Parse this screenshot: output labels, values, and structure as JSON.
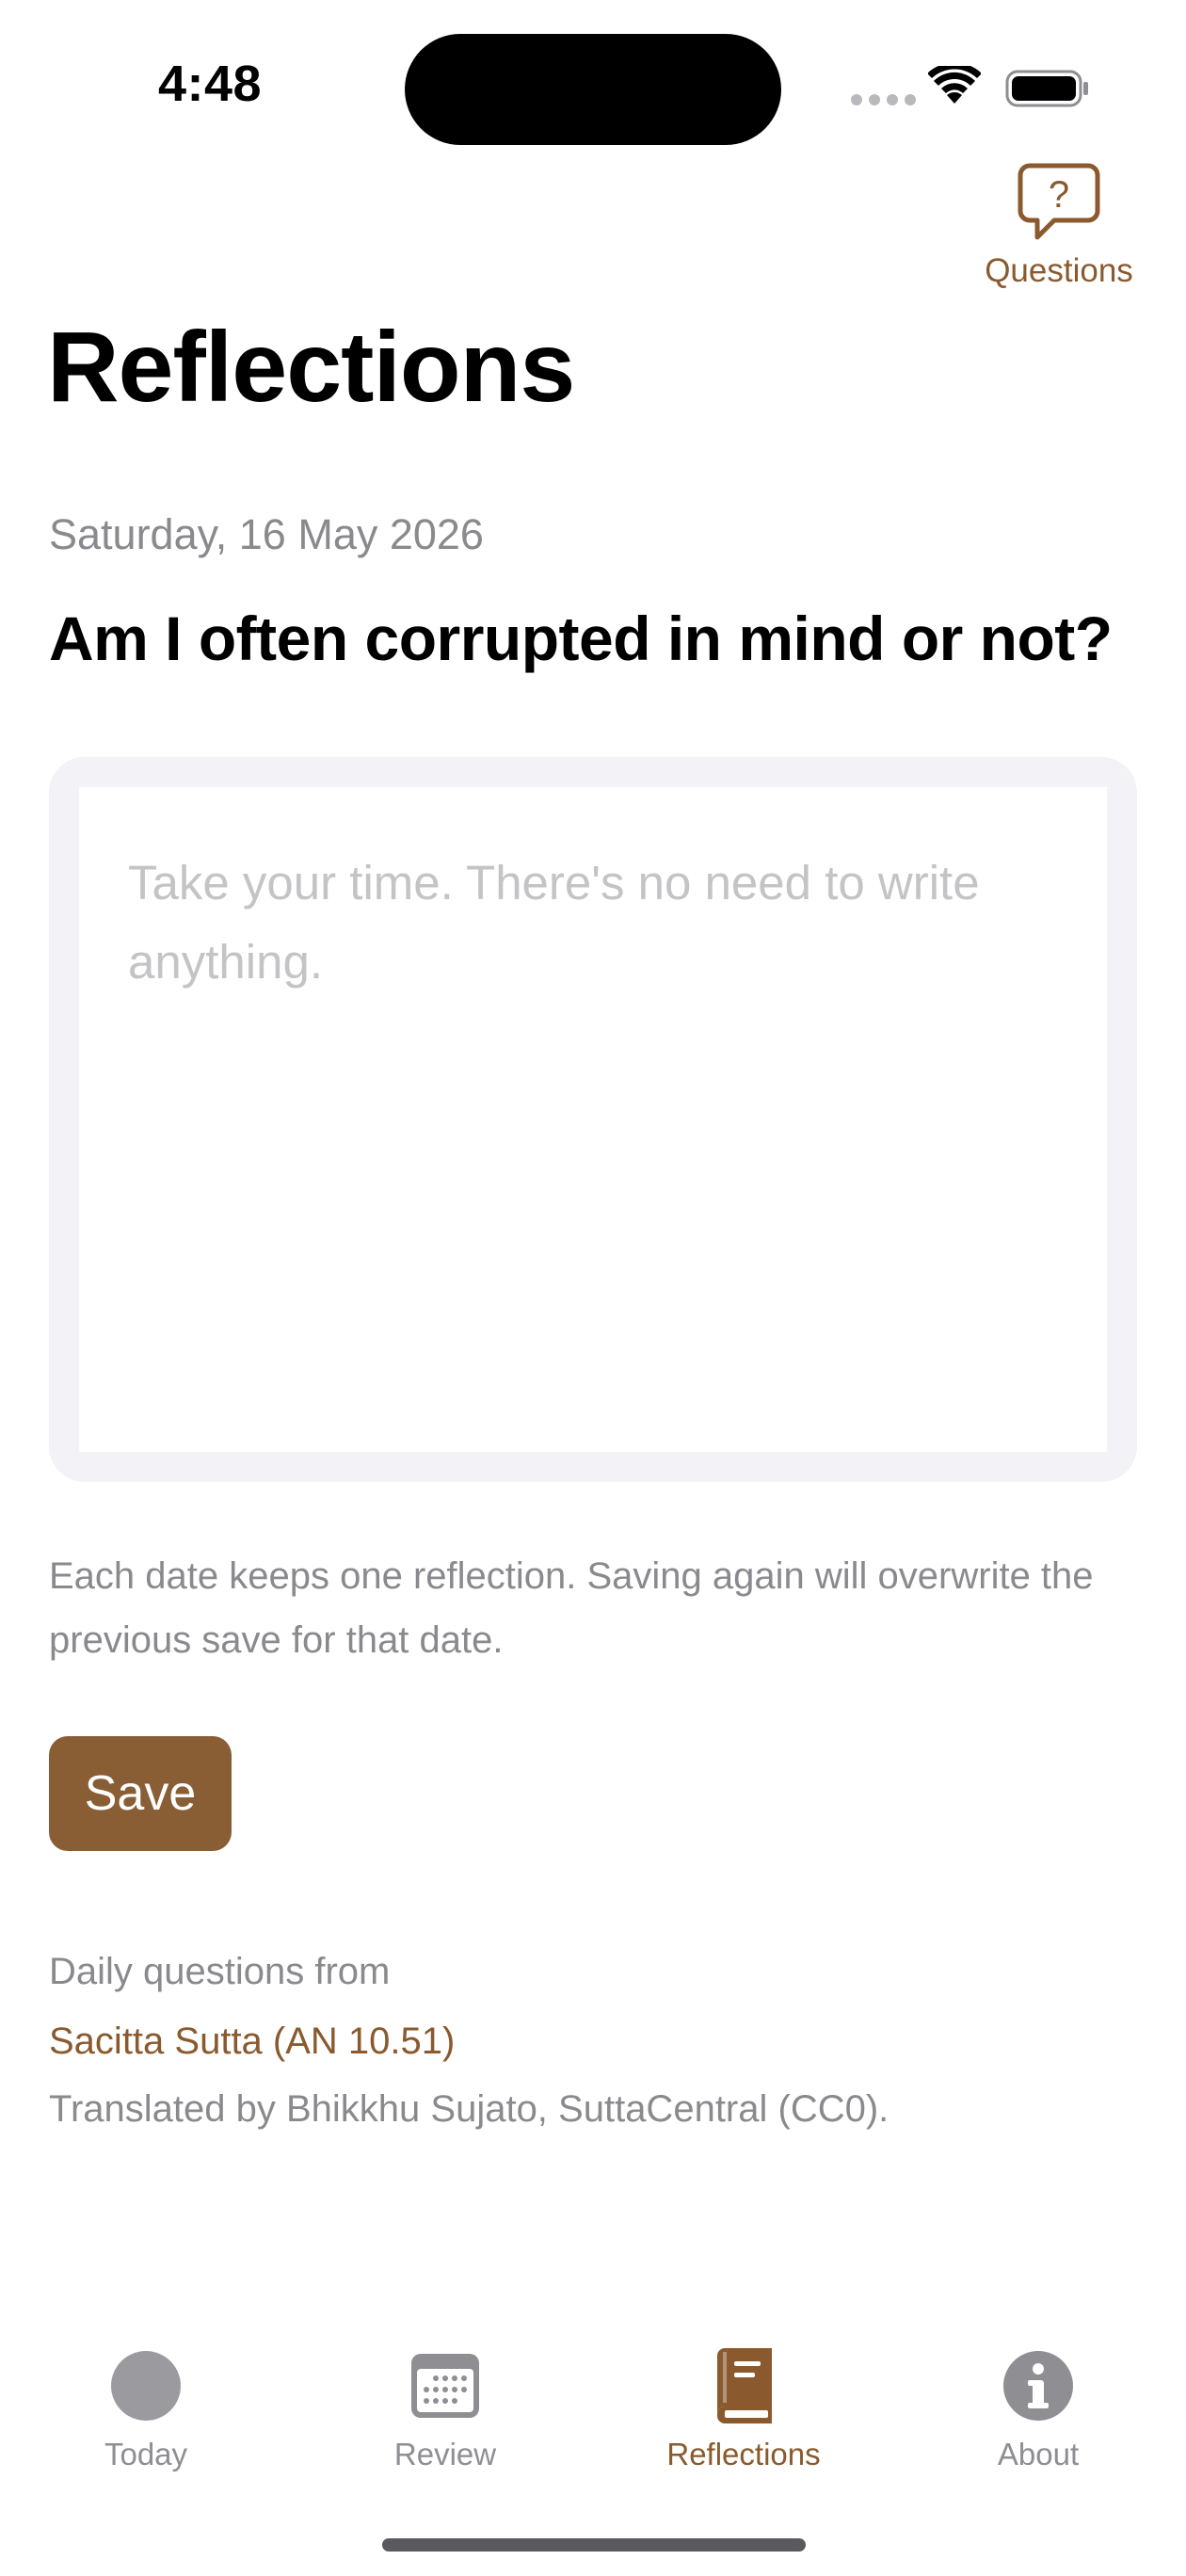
{
  "status_bar": {
    "time": "4:48"
  },
  "header": {
    "questions_label": "Questions",
    "questions_icon": "question-bubble-icon",
    "title": "Reflections"
  },
  "entry": {
    "date": "Saturday, 16 May 2026",
    "question": "Am I often corrupted in mind or not?",
    "value": "",
    "placeholder": "Take your time. There's no need to write anything.",
    "hint": "Each date keeps one reflection. Saving again will overwrite the previous save for that date.",
    "save_label": "Save"
  },
  "attribution": {
    "intro": "Daily questions from",
    "source_link": "Sacitta Sutta (AN 10.51)",
    "translation": "Translated by Bhikkhu Sujato, SuttaCentral (CC0)."
  },
  "tab_bar": {
    "items": [
      {
        "label": "Today",
        "icon": "circle-icon",
        "active": false
      },
      {
        "label": "Review",
        "icon": "calendar-icon",
        "active": false
      },
      {
        "label": "Reflections",
        "icon": "book-icon",
        "active": true
      },
      {
        "label": "About",
        "icon": "info-icon",
        "active": false
      }
    ]
  },
  "colors": {
    "accent": "#8a5a2e",
    "button_bg": "#8a5e35",
    "secondary_text": "#8a8a8e",
    "inactive_tab": "#8e8e93",
    "editor_frame": "#f2f2f7",
    "placeholder": "#c4c4c7"
  }
}
